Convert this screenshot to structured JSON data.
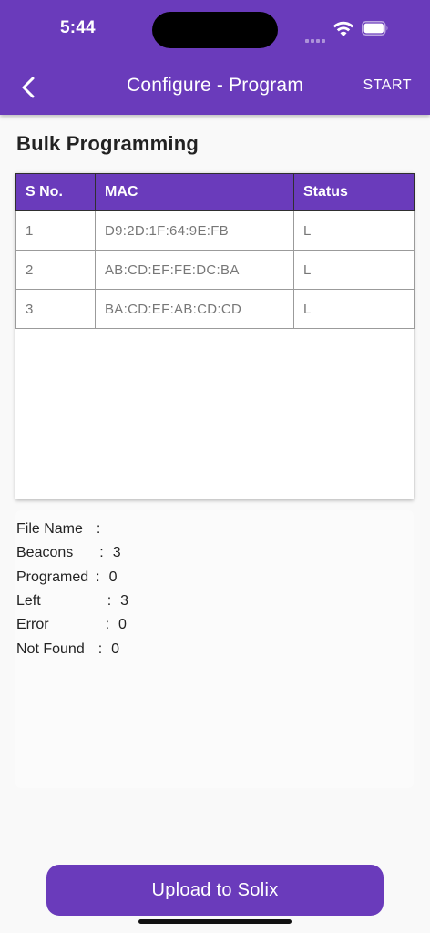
{
  "status_bar": {
    "time": "5:44"
  },
  "app_bar": {
    "title": "Configure - Program",
    "action_label": "START",
    "back_icon": "chevron-left-icon"
  },
  "section": {
    "title": "Bulk Programming"
  },
  "table": {
    "headers": [
      "S No.",
      "MAC",
      "Status"
    ],
    "rows": [
      [
        "1",
        "D9:2D:1F:64:9E:FB",
        "L"
      ],
      [
        "2",
        "AB:CD:EF:FE:DC:BA",
        "L"
      ],
      [
        "3",
        "BA:CD:EF:AB:CD:CD",
        "L"
      ]
    ]
  },
  "summary": {
    "file_name_label": "File Name",
    "file_name_value": "",
    "beacons_label": "Beacons",
    "beacons_value": "3",
    "programed_label": "Programed",
    "programed_value": "0",
    "left_label": "Left",
    "left_value": "3",
    "error_label": "Error",
    "error_value": "0",
    "not_found_label": "Not Found",
    "not_found_value": "0",
    "separator": ":"
  },
  "footer": {
    "upload_label": "Upload to Solix"
  },
  "colors": {
    "primary": "#6a3bbb",
    "background": "#f9f9f9"
  }
}
